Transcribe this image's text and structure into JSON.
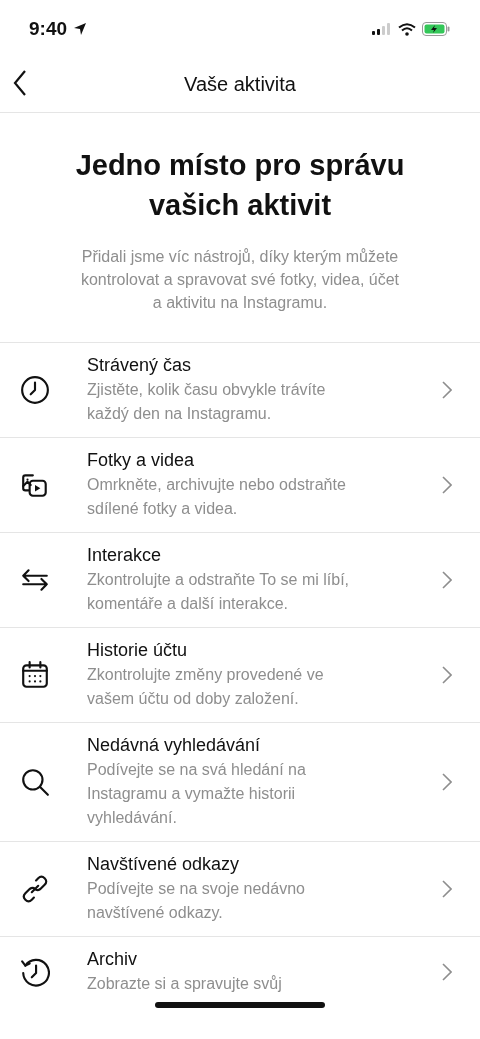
{
  "status_bar": {
    "time": "9:40"
  },
  "header": {
    "title": "Vaše aktivita"
  },
  "intro": {
    "heading": "Jedno místo pro správu vašich aktivit",
    "text": "Přidali jsme víc nástrojů, díky kterým můžete kontrolovat a spravovat své fotky, videa, účet a aktivitu na Instagramu."
  },
  "items": [
    {
      "title": "Strávený čas",
      "description": "Zjistěte, kolik času obvykle trávíte každý den na Instagramu."
    },
    {
      "title": "Fotky a videa",
      "description": "Omrkněte, archivujte nebo odstraňte sdílené fotky a videa."
    },
    {
      "title": "Interakce",
      "description": "Zkontrolujte a odstraňte To se mi líbí, komentáře a další interakce."
    },
    {
      "title": "Historie účtu",
      "description": "Zkontrolujte změny provedené ve vašem účtu od doby založení."
    },
    {
      "title": "Nedávná vyhledávání",
      "description": "Podívejte se na svá hledání na Instagramu a vymažte historii vyhledávání."
    },
    {
      "title": "Navštívené odkazy",
      "description": "Podívejte se na svoje nedávno navštívené odkazy."
    },
    {
      "title": "Archiv",
      "description": "Zobrazte si a spravujte svůj"
    }
  ]
}
